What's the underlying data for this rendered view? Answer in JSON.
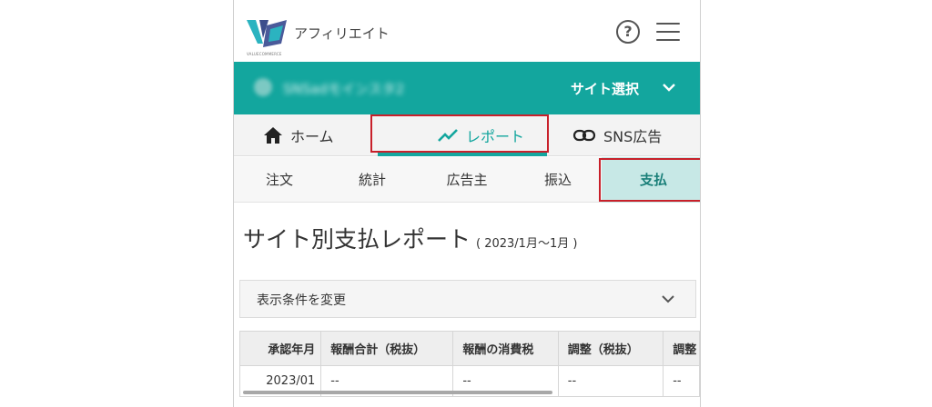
{
  "header": {
    "app_title": "アフィリエイト",
    "logo_small_text": "VALUECOMMERCE",
    "help_label": "?"
  },
  "site_bar": {
    "site_name": "SNSadモインスタ2",
    "site_select_label": "サイト選択"
  },
  "main_nav": {
    "items": [
      {
        "label": "ホーム",
        "icon": "home-icon"
      },
      {
        "label": "レポート",
        "icon": "trend-chart-icon"
      },
      {
        "label": "SNS広告",
        "icon": "link-icon"
      }
    ],
    "active": "レポート"
  },
  "sub_nav": {
    "items": [
      "注文",
      "統計",
      "広告主",
      "振込",
      "支払"
    ],
    "active": "支払"
  },
  "page": {
    "title": "サイト別支払レポート",
    "period": "( 2023/1月〜1月 )"
  },
  "filter": {
    "label": "表示条件を変更"
  },
  "table": {
    "headers": [
      "承認年月",
      "報酬合計（税抜）",
      "報酬の消費税",
      "調整（税抜）",
      "調整"
    ],
    "rows": [
      [
        "2023/01",
        "--",
        "--",
        "--",
        "--"
      ]
    ]
  },
  "colors": {
    "accent": "#13a69e",
    "highlight_border": "#c8202a",
    "active_subtab_bg": "#c7e8e6"
  }
}
